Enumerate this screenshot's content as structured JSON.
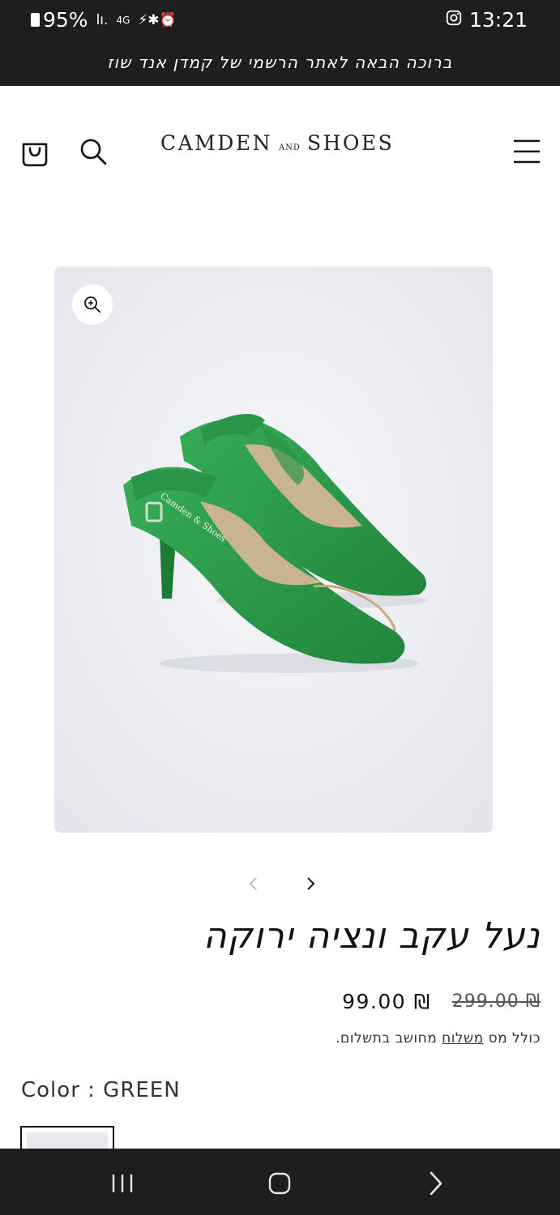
{
  "status_bar": {
    "battery": "95%",
    "signal_text": "lı.",
    "network": "4G",
    "icons_text": "⚡✱⏰",
    "time": "13:21"
  },
  "announcement": {
    "text": "ברוכה הבאה לאתר הרשמי של קמדן אנד שוז"
  },
  "header": {
    "logo_main_1": "CAMDEN",
    "logo_small": "AND",
    "logo_main_2": "SHOES"
  },
  "product": {
    "title": "נעל עקב ונציה ירוקה",
    "price": "₪ 99.00",
    "compare_price": "₪ 299.00",
    "tax_prefix": "כולל מס",
    "tax_link": "משלוח",
    "tax_suffix": "מחושב בתשלום.",
    "color_label": "Color : GREEN",
    "image_brand_text": "Camden & Shoes"
  },
  "colors": {
    "dark_bar": "#1d1e20",
    "shoe_green": "#2e9a4a",
    "image_bg": "#ecedf2"
  },
  "icons": [
    "cart-icon",
    "search-icon",
    "menu-icon",
    "zoom-icon",
    "chevron-left-icon",
    "chevron-right-icon",
    "recents-icon",
    "home-icon",
    "back-icon"
  ]
}
